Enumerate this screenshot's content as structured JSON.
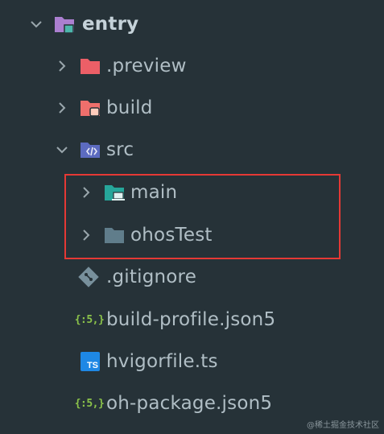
{
  "tree": {
    "root": {
      "label": "entry",
      "expanded": true,
      "icon": "module-folder-icon"
    },
    "items": [
      {
        "label": ".preview",
        "type": "folder",
        "icon": "folder-icon",
        "color": "#ec5f67"
      },
      {
        "label": "build",
        "type": "folder",
        "icon": "build-folder-icon",
        "color": "#ef6f6c"
      },
      {
        "label": "src",
        "type": "folder",
        "icon": "src-folder-icon",
        "color": "#5c6bc0",
        "expanded": true
      },
      {
        "label": "main",
        "type": "folder",
        "icon": "main-folder-icon",
        "color": "#26a69a"
      },
      {
        "label": "ohosTest",
        "type": "folder",
        "icon": "folder-icon",
        "color": "#607d8b"
      },
      {
        "label": ".gitignore",
        "type": "file",
        "icon": "git-icon"
      },
      {
        "label": "build-profile.json5",
        "type": "file",
        "icon": "json5-icon",
        "icon_text": "{:5,}"
      },
      {
        "label": "hvigorfile.ts",
        "type": "file",
        "icon": "typescript-icon",
        "icon_text": "TS"
      },
      {
        "label": "oh-package.json5",
        "type": "file",
        "icon": "json5-icon",
        "icon_text": "{:5,}"
      }
    ]
  },
  "watermark": "@稀土掘金技术社区",
  "colors": {
    "background": "#263238",
    "text": "#b0bec5",
    "highlight_border": "#e53935"
  }
}
